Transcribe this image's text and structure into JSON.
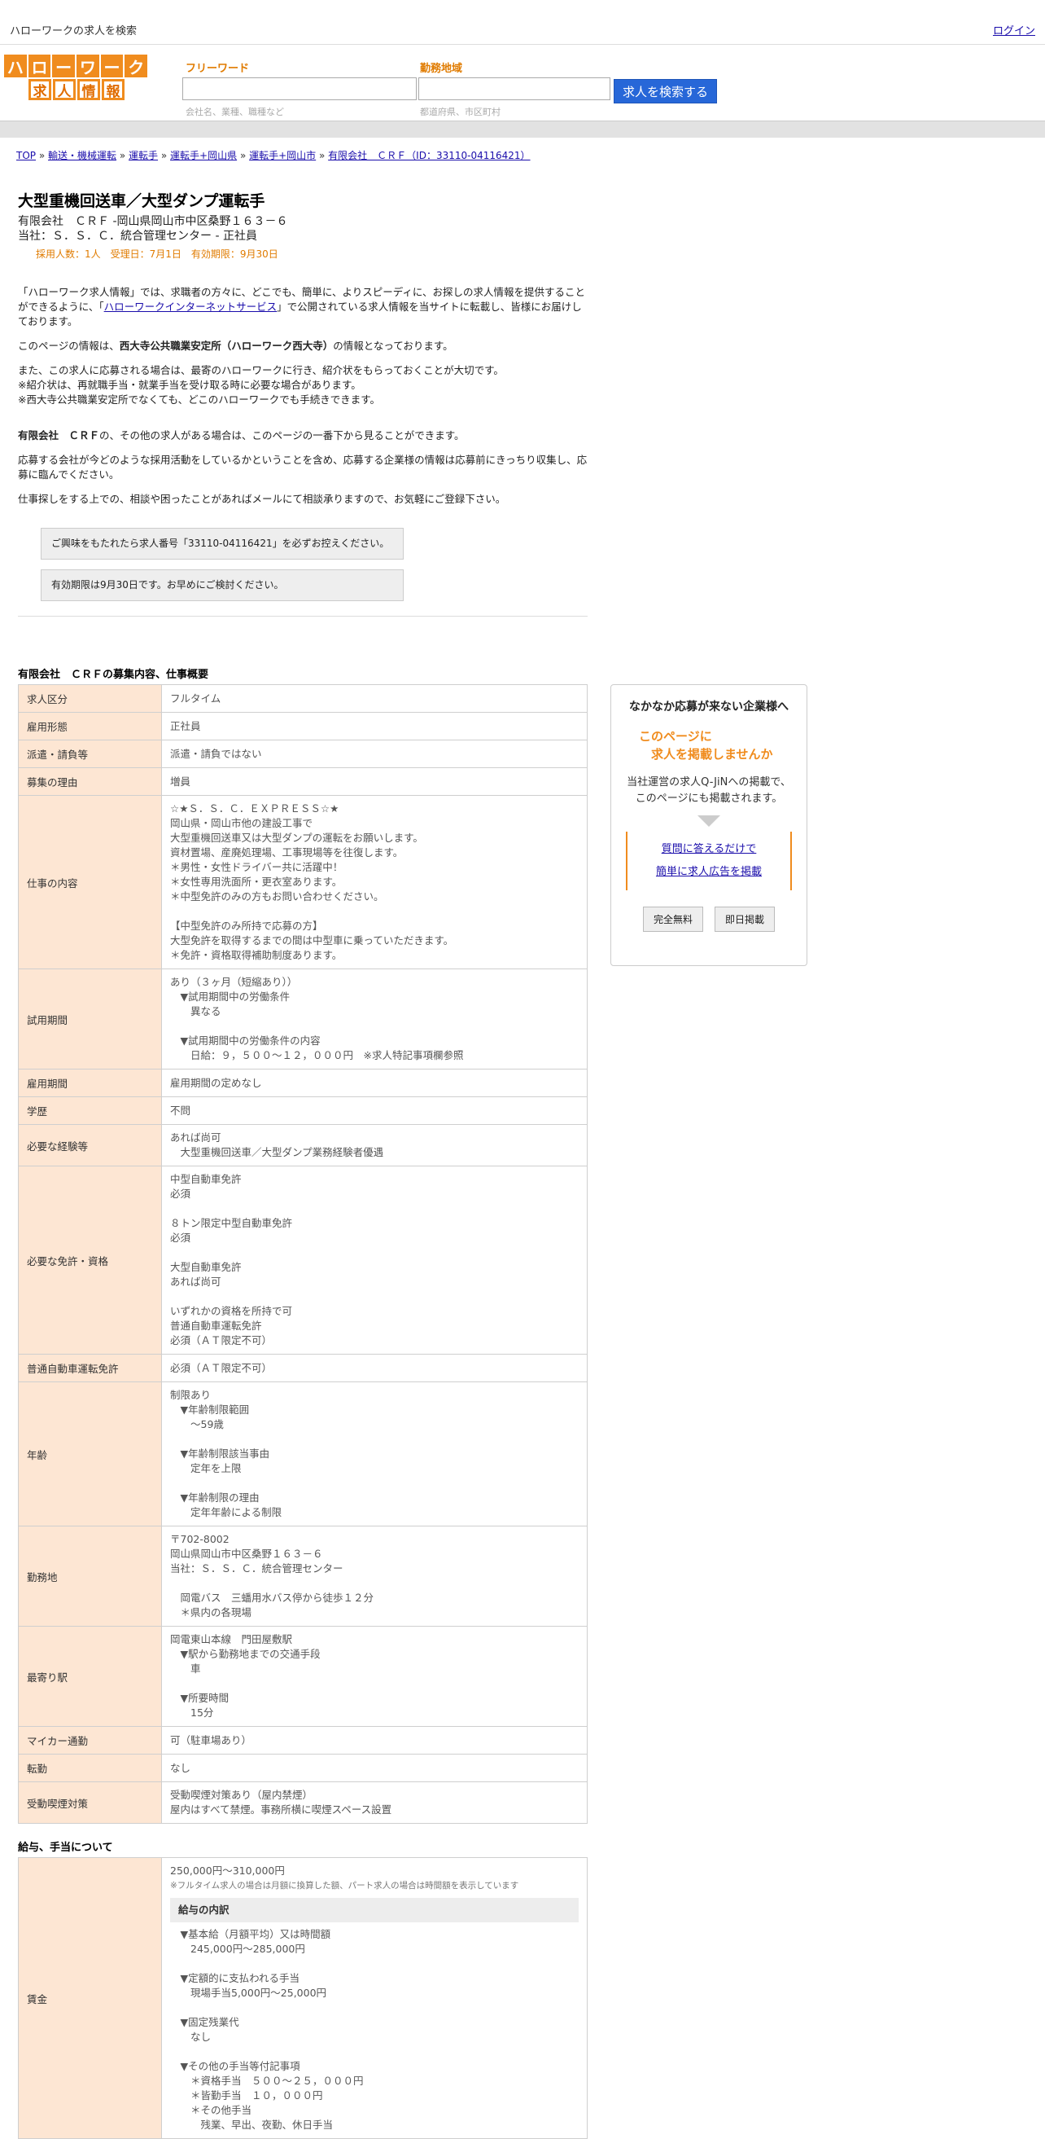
{
  "topbar": {
    "site_title": "ハローワークの求人を検索",
    "login": "ログイン"
  },
  "header": {
    "logo_top": [
      "ハ",
      "ロ",
      "ー",
      "ワ",
      "ー",
      "ク"
    ],
    "logo_bottom": [
      "求",
      "人",
      "情",
      "報"
    ],
    "freeword_label": "フリーワード",
    "area_label": "勤務地域",
    "freeword_hint": "会社名、業種、職種など",
    "area_hint": "都道府県、市区町村",
    "search_button": "求人を検索する"
  },
  "breadcrumb": {
    "items": [
      "TOP",
      "輸送・機械運転",
      "運転手",
      "運転手+岡山県",
      "運転手+岡山市",
      "有限会社　ＣＲＦ（ID：33110-04116421）"
    ],
    "sep": "»"
  },
  "job": {
    "title": "大型重機回送車／大型ダンプ運転手",
    "company_line": "有限会社　ＣＲＦ -岡山県岡山市中区桑野１６３－６",
    "branch_line": "当社：Ｓ．Ｓ．Ｃ．統合管理センター - 正社員",
    "meta": "採用人数：1人　受理日：7月1日　有効期限：9月30日"
  },
  "intro": {
    "p1a": "「ハローワーク求人情報」では、求職者の方々に、どこでも、簡単に、よりスピーディに、お探しの求人情報を提供することができるように、「",
    "p1link": "ハローワークインターネットサービス",
    "p1b": "」で公開されている求人情報を当サイトに転載し、皆様にお届けしております。",
    "p2a": "このページの情報は、",
    "p2b": "西大寺公共職業安定所（ハローワーク西大寺）",
    "p2c": "の情報となっております。",
    "p3_1": "また、この求人に応募される場合は、最寄のハローワークに行き、紹介状をもらっておくことが大切です。",
    "p3_2": "※紹介状は、再就職手当・就業手当を受け取る時に必要な場合があります。",
    "p3_3": "※西大寺公共職業安定所でなくても、どこのハローワークでも手続きできます。",
    "p4a": "有限会社　ＣＲＦ",
    "p4b": "の、その他の求人がある場合は、このページの一番下から見ることができます。",
    "p5": "応募する会社が今どのような採用活動をしているかということを含め、応募する企業様の情報は応募前にきっちり収集し、応募に臨んでください。",
    "p6": "仕事探しをする上での、相談や困ったことがあればメールにて相談承りますので、お気軽にご登録下さい。",
    "note1": "ご興味をもたれたら求人番号「33110-04116421」を必ずお控えください。",
    "note2": "有効期限は9月30日です。お早めにご検討ください。"
  },
  "section1": {
    "heading": "有限会社　ＣＲＦの募集内容、仕事概要",
    "rows": [
      {
        "k": "求人区分",
        "v": "フルタイム"
      },
      {
        "k": "雇用形態",
        "v": "正社員"
      },
      {
        "k": "派遣・請負等",
        "v": "派遣・請負ではない"
      },
      {
        "k": "募集の理由",
        "v": "増員"
      },
      {
        "k": "仕事の内容",
        "v": "☆★Ｓ．Ｓ．Ｃ．ＥＸＰＲＥＳＳ☆★\n岡山県・岡山市他の建設工事で\n大型重機回送車又は大型ダンプの運転をお願いします。\n資材置場、産廃処理場、工事現場等を往復します。\n＊男性・女性ドライバー共に活躍中！\n＊女性専用洗面所・更衣室あります。\n＊中型免許のみの方もお問い合わせください。\n\n【中型免許のみ所持で応募の方】\n大型免許を取得するまでの間は中型車に乗っていただきます。\n＊免許・資格取得補助制度あります。"
      },
      {
        "k": "試用期間",
        "v": "あり（３ヶ月（短縮あり））\n　▼試用期間中の労働条件\n　　異なる\n\n　▼試用期間中の労働条件の内容\n　　日給：９，５００～１２，０００円　※求人特記事項欄参照"
      },
      {
        "k": "雇用期間",
        "v": "雇用期間の定めなし"
      },
      {
        "k": "学歴",
        "v": "不問"
      },
      {
        "k": "必要な経験等",
        "v": "あれば尚可\n　大型重機回送車／大型ダンプ業務経験者優遇"
      },
      {
        "k": "必要な免許・資格",
        "v": "中型自動車免許\n必須\n\n８トン限定中型自動車免許\n必須\n\n大型自動車免許\nあれば尚可\n\nいずれかの資格を所持で可\n普通自動車運転免許\n必須（ＡＴ限定不可）"
      },
      {
        "k": "普通自動車運転免許",
        "v": "必須（ＡＴ限定不可）"
      },
      {
        "k": "年齢",
        "v": "制限あり\n　▼年齢制限範囲\n　　〜59歳\n\n　▼年齢制限該当事由\n　　定年を上限\n\n　▼年齢制限の理由\n　　定年年齢による制限"
      },
      {
        "k": "勤務地",
        "v": "〒702-8002\n岡山県岡山市中区桑野１６３－６\n当社：Ｓ．Ｓ．Ｃ．統合管理センター\n\n　岡電バス　三蟠用水バス停から徒歩１２分\n　＊県内の各現場"
      },
      {
        "k": "最寄り駅",
        "v": "岡電東山本線　門田屋敷駅\n　▼駅から勤務地までの交通手段\n　　車\n\n　▼所要時間\n　　15分"
      },
      {
        "k": "マイカー通勤",
        "v": "可（駐車場あり）"
      },
      {
        "k": "転勤",
        "v": "なし"
      },
      {
        "k": "受動喫煙対策",
        "v": "受動喫煙対策あり（屋内禁煙）\n屋内はすべて禁煙。事務所横に喫煙スペース設置"
      }
    ]
  },
  "section2": {
    "heading": "給与、手当について",
    "key": "賃金",
    "range": "250,000円〜310,000円",
    "note": "※フルタイム求人の場合は月額に換算した額、パート求人の場合は時間額を表示しています",
    "sub": "給与の内訳",
    "detail": "　▼基本給（月額平均）又は時間額\n　　245,000円〜285,000円\n\n　▼定額的に支払われる手当\n　　現場手当5,000円〜25,000円\n\n　▼固定残業代\n　　なし\n\n　▼その他の手当等付記事項\n　　＊資格手当　５００～２５，０００円\n　　＊皆勤手当　１０，０００円\n　　＊その他手当\n　　　残業、早出、夜勤、休日手当"
  },
  "sidebar": {
    "heading": "なかなか応募が来ない企業様へ",
    "offer1": "このページに",
    "offer2": "　求人を掲載しませんか",
    "desc1": "当社運営の求人Q-JiNへの掲載で、",
    "desc2": "このページにも掲載されます。",
    "link1": "質問に答えるだけで",
    "link2": "簡単に求人広告を掲載",
    "btn1": "完全無料",
    "btn2": "即日掲載"
  }
}
